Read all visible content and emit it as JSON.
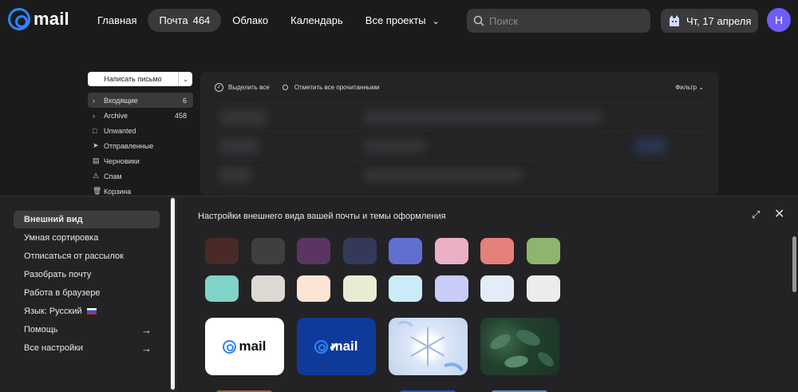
{
  "app": {
    "logo_text": "mail"
  },
  "nav": {
    "items": [
      {
        "label": "Главная"
      },
      {
        "label": "Почта",
        "count": "464"
      },
      {
        "label": "Облако"
      },
      {
        "label": "Календарь"
      },
      {
        "label": "Все проекты"
      }
    ]
  },
  "search": {
    "placeholder": "Поиск"
  },
  "date_widget": {
    "label": "Чт, 17 апреля"
  },
  "user": {
    "avatar_letter": "Н"
  },
  "compose": {
    "label": "Написать письмо"
  },
  "folders": [
    {
      "label": "Входящие",
      "count": "6"
    },
    {
      "label": "Archive",
      "count": "458"
    },
    {
      "label": "Unwanted"
    },
    {
      "label": "Отправленные"
    },
    {
      "label": "Черновики"
    },
    {
      "label": "Спам"
    },
    {
      "label": "Корзина"
    }
  ],
  "list_toolbar": {
    "select_all": "Выделить все",
    "mark_read": "Отметить все прочитанными",
    "filter": "Фильтр"
  },
  "settings": {
    "title": "Настройки внешнего вида вашей почты и темы оформления",
    "menu": [
      {
        "label": "Внешний вид"
      },
      {
        "label": "Умная сортировка"
      },
      {
        "label": "Отписаться от рассылок"
      },
      {
        "label": "Разобрать почту"
      },
      {
        "label": "Работа в браузере"
      },
      {
        "label": "Язык: Русский"
      },
      {
        "label": "Помощь"
      },
      {
        "label": "Все настройки"
      }
    ],
    "swatches_row1": [
      "#4a2a26",
      "#3e3f40",
      "#5a3563",
      "#34395c",
      "#6170cf",
      "#e9b0c6",
      "#e6807a",
      "#8fb46f"
    ],
    "swatches_row2": [
      "#7fd3c8",
      "#ddd8d2",
      "#fde5d6",
      "#e8ecd1",
      "#c9ecf6",
      "#c8ccf6",
      "#e3ecf8",
      "#ececec"
    ],
    "themes": [
      {
        "logo": "mail",
        "name": "mail-light"
      },
      {
        "logo": "mail",
        "name": "mail-blue",
        "selected": true
      },
      {
        "name": "snowflake"
      },
      {
        "name": "leaves"
      }
    ]
  },
  "icons": {
    "search": "search-icon",
    "chevron": "chevron-down-icon",
    "cat": "cat-weather-icon",
    "expand": "expand-icon",
    "close": "close-icon",
    "arrow": "arrow-right-icon",
    "flag": "ru-flag-icon"
  }
}
